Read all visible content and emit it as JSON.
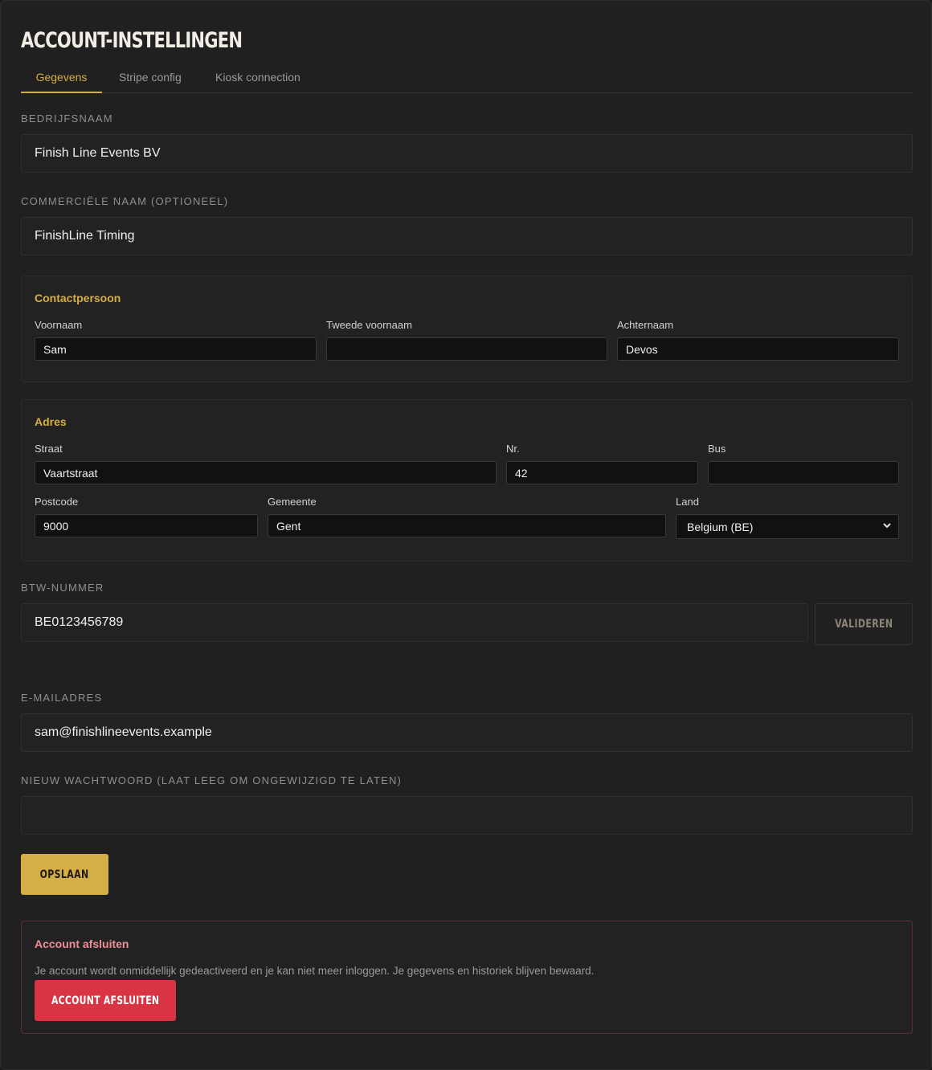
{
  "page": {
    "title": "Account-instellingen"
  },
  "tabs": [
    {
      "label": "Gegevens",
      "active": true
    },
    {
      "label": "Stripe config",
      "active": false
    },
    {
      "label": "Kiosk connection",
      "active": false
    }
  ],
  "company": {
    "label": "Bedrijfsnaam",
    "value": "Finish Line Events BV"
  },
  "commercial": {
    "label": "Commerciële naam (optioneel)",
    "value": "FinishLine Timing"
  },
  "contact": {
    "title": "Contactpersoon",
    "first_name_label": "Voornaam",
    "first_name": "Sam",
    "middle_name_label": "Tweede voornaam",
    "middle_name": "",
    "last_name_label": "Achternaam",
    "last_name": "Devos"
  },
  "address": {
    "title": "Adres",
    "street_label": "Straat",
    "street": "Vaartstraat",
    "number_label": "Nr.",
    "number": "42",
    "bus_label": "Bus",
    "bus": "",
    "postcode_label": "Postcode",
    "postcode": "9000",
    "city_label": "Gemeente",
    "city": "Gent",
    "country_label": "Land",
    "country": "Belgium (BE)"
  },
  "vat": {
    "label": "BTW-nummer",
    "value": "BE0123456789",
    "validate_label": "Valideren"
  },
  "email": {
    "label": "E-mailadres",
    "value": "sam@finishlineevents.example"
  },
  "password": {
    "label": "Nieuw wachtwoord (laat leeg om ongewijzigd te laten)",
    "value": ""
  },
  "save_label": "Opslaan",
  "danger": {
    "title": "Account afsluiten",
    "text": "Je account wordt onmiddellijk gedeactiveerd en je kan niet meer inloggen. Je gegevens en historiek blijven bewaard.",
    "button_label": "Account afsluiten"
  },
  "colors": {
    "accent": "#d6ae46",
    "danger": "#d93444",
    "background": "#202020"
  }
}
